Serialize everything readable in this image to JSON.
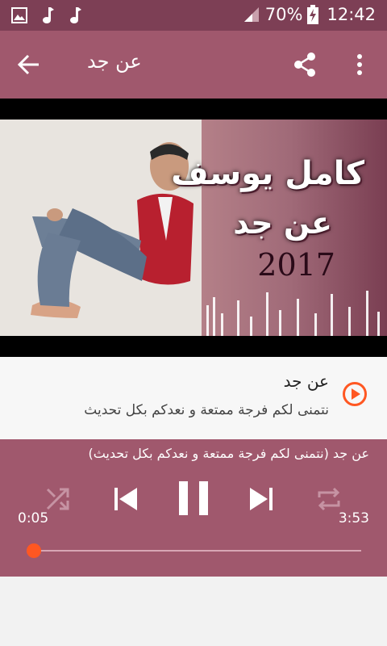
{
  "status_bar": {
    "icons": [
      "image-icon",
      "music-note-icon",
      "music-note-icon"
    ],
    "battery": "70%",
    "time": "12:42"
  },
  "app_bar": {
    "title": "عن جد"
  },
  "banner": {
    "artist_text": "كامل يوسف",
    "song_text": "عن جد",
    "year_text": "2017"
  },
  "track": {
    "title": "عن جد",
    "description": "نتمنى لكم فرجة ممتعة و نعدكم بكل تحديث"
  },
  "player": {
    "now_playing": "عن جد (نتمنى لكم فرجة ممتعة و نعدكم بكل تحديث)",
    "current_time": "0:05",
    "total_time": "3:53",
    "progress": 0.02,
    "accent_color": "#ff5722"
  },
  "colors": {
    "statusbar": "#7d3f55",
    "appbar": "#a0586d"
  }
}
